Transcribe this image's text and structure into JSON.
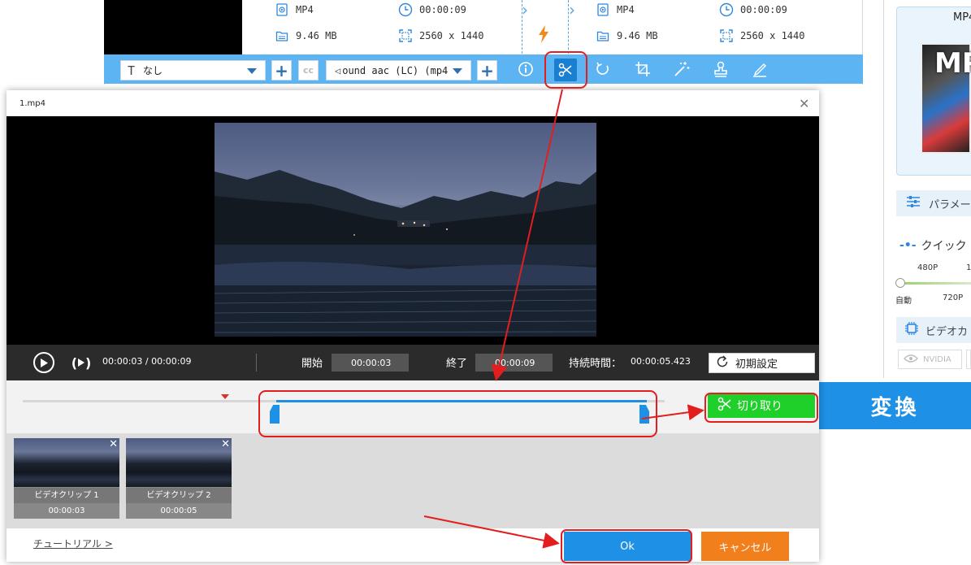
{
  "source": {
    "format": "MP4",
    "duration": "00:00:09",
    "size": "9.46 MB",
    "resolution": "2560 x 1440"
  },
  "output": {
    "format": "MP4",
    "duration": "00:00:09",
    "size": "9.46 MB",
    "resolution": "2560 x 1440"
  },
  "toolbar": {
    "subtitle_value": "なし",
    "audio_value": "ound aac (LC) (mp4"
  },
  "right_panel": {
    "format_label": "MP4",
    "cover_text": "MP",
    "params_label": "パラメー",
    "quick_label": "クイック",
    "quality_ticks_top": [
      "480P",
      "1"
    ],
    "quality_ticks_bottom": [
      "自動",
      "720P"
    ],
    "gpu_label": "ビデオカ",
    "nvidia_label": "NVIDIA",
    "convert_label": "変換"
  },
  "dialog": {
    "title": "1.mp4",
    "close": "✕",
    "current_time": "00:00:03 / 00:00:09",
    "start_label": "開始",
    "start_value": "00:00:03",
    "end_label": "終了",
    "end_value": "00:00:09",
    "duration_label": "持続時間：",
    "duration_value": "00:00:05.423",
    "reset_label": "初期設定",
    "cut_label": "切り取り",
    "clips": [
      {
        "name": "ビデオクリップ 1",
        "duration": "00:00:03"
      },
      {
        "name": "ビデオクリップ 2",
        "duration": "00:00:05"
      }
    ],
    "tutorial_label": "チュートリアル >",
    "ok_label": "Ok",
    "cancel_label": "キャンセル"
  },
  "colors": {
    "accent_blue": "#1e90e6",
    "toolbar_blue": "#5db4f2",
    "cut_green": "#1fcf2a",
    "cancel_orange": "#f07f1c",
    "annotation_red": "#e31e1e"
  }
}
